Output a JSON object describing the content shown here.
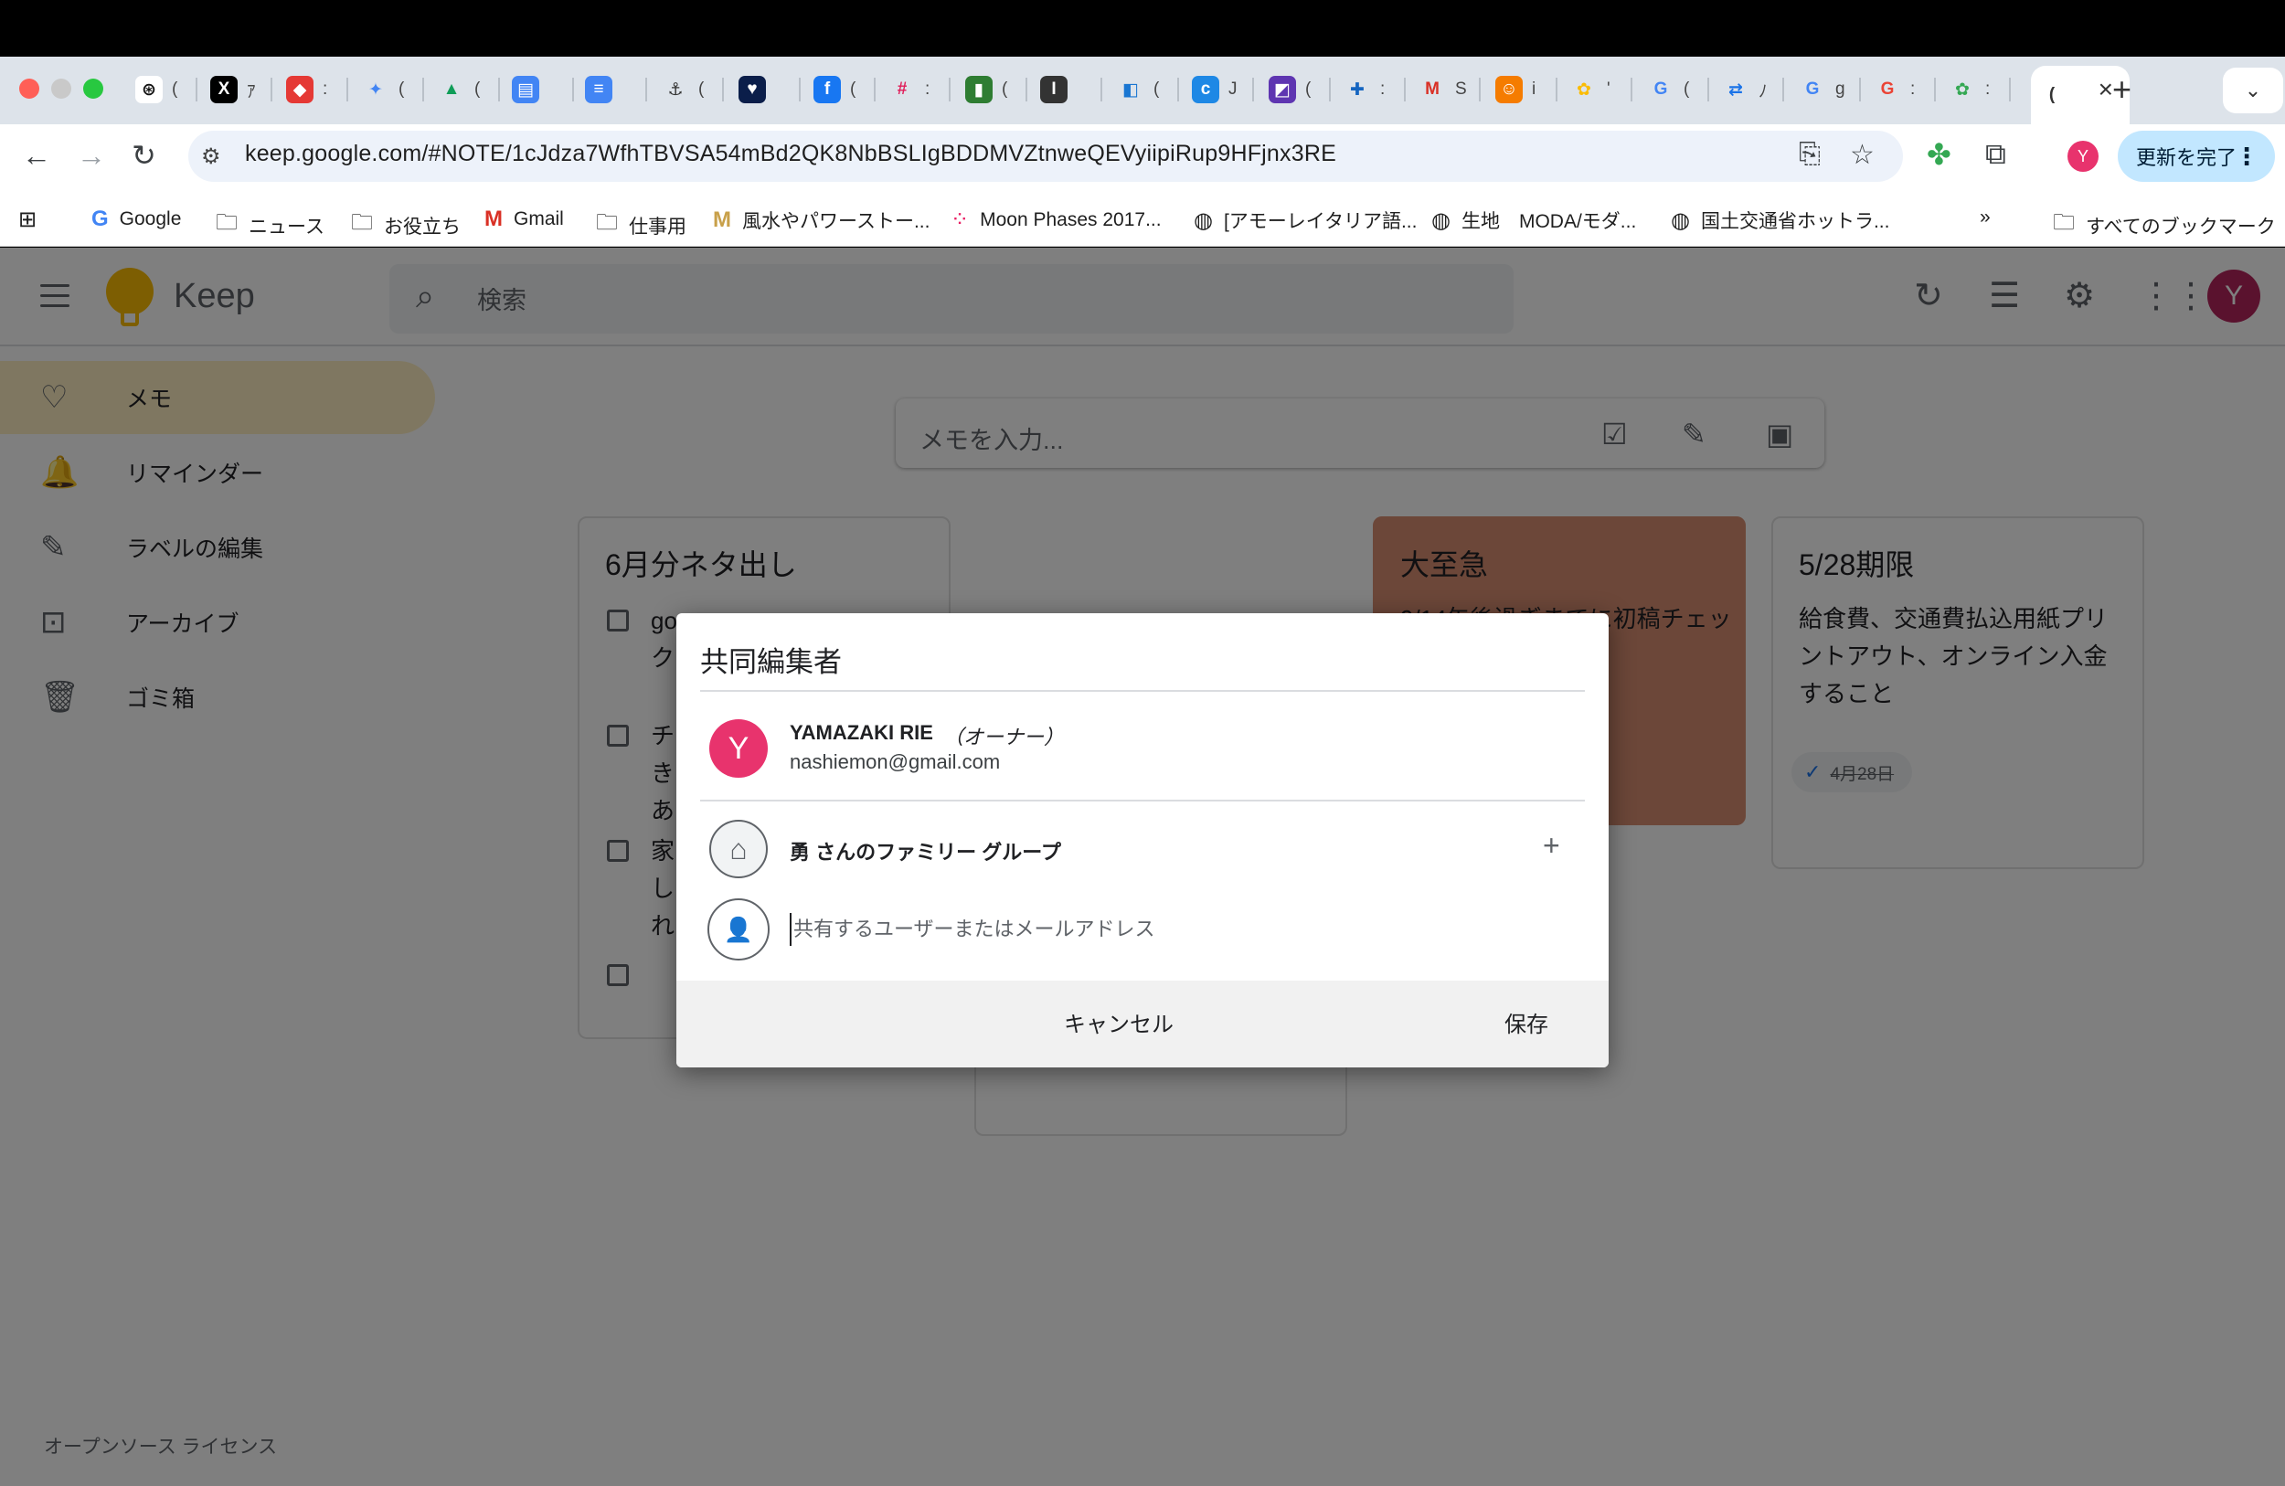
{
  "browser": {
    "url": "keep.google.com/#NOTE/1cJdza7WfhTBVSA54mBd2QK8NbBSLIgBDDMVZtnweQEVyiipiRup9HFjnx3RE",
    "update_button": "更新を完了",
    "profile_initial": "Y",
    "tab_overflow": "⌄",
    "tabs": [
      {
        "icon": "⊛",
        "color": "#ffffff",
        "fg": "#111111",
        "cut": "("
      },
      {
        "icon": "X",
        "color": "#000000",
        "fg": "#ffffff",
        "cut": "ｱ"
      },
      {
        "icon": "◆",
        "color": "#e53935",
        "fg": "#ffffff",
        "cut": ":"
      },
      {
        "icon": "✦",
        "color": "#dde3ea",
        "fg": "#4285f4",
        "cut": "("
      },
      {
        "icon": "▲",
        "color": "#dde3ea",
        "fg": "#0f9d58",
        "cut": "("
      },
      {
        "icon": "▤",
        "color": "#4285f4",
        "fg": "#ffffff",
        "cut": ""
      },
      {
        "icon": "≡",
        "color": "#4285f4",
        "fg": "#ffffff",
        "cut": ""
      },
      {
        "icon": "⚓",
        "color": "#dde3ea",
        "fg": "#333333",
        "cut": "("
      },
      {
        "icon": "♥",
        "color": "#0b1e4a",
        "fg": "#ffffff",
        "cut": ""
      },
      {
        "icon": "f",
        "color": "#1877f2",
        "fg": "#ffffff",
        "cut": "("
      },
      {
        "icon": "#",
        "color": "#dde3ea",
        "fg": "#e01e5a",
        "cut": ":"
      },
      {
        "icon": "▮",
        "color": "#2e7d32",
        "fg": "#ffffff",
        "cut": "("
      },
      {
        "icon": "I",
        "color": "#333333",
        "fg": "#ffffff",
        "cut": ""
      },
      {
        "icon": "◧",
        "color": "#dde3ea",
        "fg": "#1976d2",
        "cut": "("
      },
      {
        "icon": "c",
        "color": "#1e88e5",
        "fg": "#ffffff",
        "cut": "J"
      },
      {
        "icon": "◩",
        "color": "#5e35b1",
        "fg": "#ffffff",
        "cut": "("
      },
      {
        "icon": "✚",
        "color": "#dde3ea",
        "fg": "#1565c0",
        "cut": ":"
      },
      {
        "icon": "M",
        "color": "#dde3ea",
        "fg": "#d93025",
        "cut": "S"
      },
      {
        "icon": "☺",
        "color": "#f57c00",
        "fg": "#ffffff",
        "cut": "i"
      },
      {
        "icon": "✿",
        "color": "#dde3ea",
        "fg": "#fbbc04",
        "cut": "'"
      },
      {
        "icon": "G",
        "color": "#dde3ea",
        "fg": "#4285f4",
        "cut": "("
      },
      {
        "icon": "⇄",
        "color": "#dde3ea",
        "fg": "#1a73e8",
        "cut": "ﾉ"
      },
      {
        "icon": "G",
        "color": "#dde3ea",
        "fg": "#4285f4",
        "cut": "g"
      },
      {
        "icon": "G",
        "color": "#dde3ea",
        "fg": "#ea4335",
        "cut": ":"
      },
      {
        "icon": "✿",
        "color": "#dde3ea",
        "fg": "#34a853",
        "cut": ":"
      },
      {
        "icon": "(",
        "color": "#ffffff",
        "fg": "#333333",
        "cut": ""
      }
    ],
    "bookmarks": [
      {
        "icon": "G",
        "label": "Google"
      },
      {
        "icon": "🗀",
        "label": "ニュース"
      },
      {
        "icon": "🗀",
        "label": "お役立ち"
      },
      {
        "icon": "M",
        "label": "Gmail"
      },
      {
        "icon": "🗀",
        "label": "仕事用"
      },
      {
        "icon": "M",
        "label": "風水やパワーストー..."
      },
      {
        "icon": "⁘",
        "label": "Moon Phases 2017..."
      },
      {
        "icon": "◍",
        "label": "[アモーレイタリア語..."
      },
      {
        "icon": "◍",
        "label": "生地　MODA/モダ..."
      },
      {
        "icon": "◍",
        "label": "国土交通省ホットラ..."
      }
    ],
    "bookmarks_overflow": "»",
    "all_bookmarks": "すべてのブックマーク"
  },
  "keep": {
    "app_name": "Keep",
    "search_placeholder": "検索",
    "avatar_initial": "Y",
    "sidebar": [
      {
        "icon": "♡",
        "label": "メモ",
        "active": true
      },
      {
        "icon": "🔔",
        "label": "リマインダー",
        "active": false
      },
      {
        "icon": "✎",
        "label": "ラベルの編集",
        "active": false
      },
      {
        "icon": "⊡",
        "label": "アーカイブ",
        "active": false
      },
      {
        "icon": "🗑",
        "label": "ゴミ箱",
        "active": false
      }
    ],
    "take_note_placeholder": "メモを入力...",
    "notes": {
      "june": {
        "title": "6月分ネタ出し",
        "items": [
          "go",
          "チ",
          "家"
        ],
        "lines": [
          "ク",
          "き",
          "あ",
          "し",
          "れ"
        ]
      },
      "urgent": {
        "title": "大至急",
        "body": "9/14午後過ぎまでに初稿チェッ",
        "color": "#d98e73"
      },
      "deadline": {
        "title": "5/28期限",
        "body": "給食費、交通費払込用紙プリントアウト、オンライン入金すること",
        "reminder": "4月28日"
      }
    },
    "footer_link": "オープンソース ライセンス"
  },
  "dialog": {
    "title": "共同編集者",
    "owner": {
      "initial": "Y",
      "name": "YAMAZAKI RIE",
      "role": "（オーナー）",
      "email": "nashiemon@gmail.com"
    },
    "group": {
      "name": "勇 さんのファミリー グループ"
    },
    "share_placeholder": "共有するユーザーまたはメールアドレス",
    "cancel": "キャンセル",
    "save": "保存"
  }
}
